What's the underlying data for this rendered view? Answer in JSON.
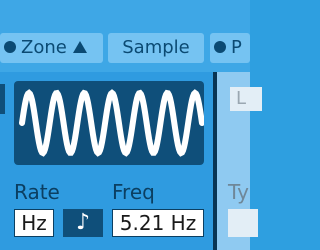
{
  "tabs": [
    {
      "label": "Zone",
      "icon": "dot-icon",
      "trailing_icon": "triangle-up-icon"
    },
    {
      "label": "Sample"
    },
    {
      "label": "P",
      "icon": "dot-icon"
    }
  ],
  "lfo": {
    "waveform": "sine",
    "rate": {
      "label": "Rate",
      "value": "Hz"
    },
    "sync_icon": "music-note-icon",
    "freq": {
      "label": "Freq",
      "value": "5.21 Hz"
    }
  },
  "right_panel": {
    "box_text": "L",
    "label": "Ty"
  },
  "colors": {
    "background": "#2e9fe0",
    "tab": "#75c3f2",
    "dark": "#0f4f7a",
    "text": "#0b3f62"
  }
}
